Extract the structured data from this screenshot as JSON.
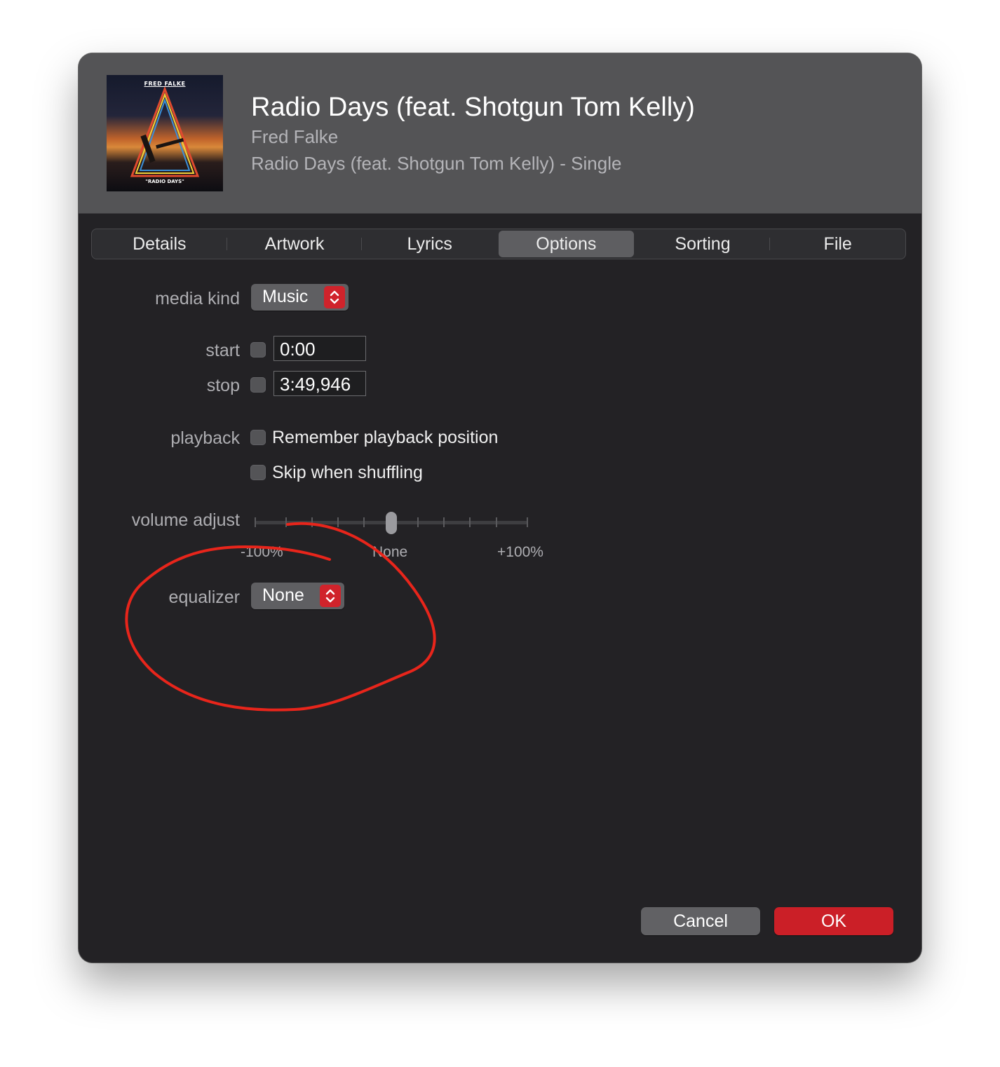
{
  "header": {
    "title": "Radio Days (feat. Shotgun Tom Kelly)",
    "artist": "Fred Falke",
    "album": "Radio Days (feat. Shotgun Tom Kelly) - Single",
    "artwork": {
      "top_text": "FRED FALKE",
      "bottom_text": "\"RADIO DAYS\""
    }
  },
  "tabs": [
    {
      "label": "Details"
    },
    {
      "label": "Artwork"
    },
    {
      "label": "Lyrics"
    },
    {
      "label": "Options",
      "active": true
    },
    {
      "label": "Sorting"
    },
    {
      "label": "File"
    }
  ],
  "options": {
    "media_kind": {
      "label": "media kind",
      "value": "Music"
    },
    "start": {
      "label": "start",
      "value": "0:00",
      "checked": false
    },
    "stop": {
      "label": "stop",
      "value": "3:49,946",
      "checked": false
    },
    "playback": {
      "label": "playback",
      "remember": {
        "label": "Remember playback position",
        "checked": false
      },
      "skip": {
        "label": "Skip when shuffling",
        "checked": false
      }
    },
    "volume_adjust": {
      "label": "volume adjust",
      "value_percent": 0,
      "min_label": "-100%",
      "mid_label": "None",
      "max_label": "+100%"
    },
    "equalizer": {
      "label": "equalizer",
      "value": "None"
    }
  },
  "buttons": {
    "cancel": "Cancel",
    "ok": "OK"
  },
  "colors": {
    "accent": "#cb1f27",
    "annotation": "#e8251b",
    "window_bg": "#232225",
    "header_bg": "#545456"
  }
}
